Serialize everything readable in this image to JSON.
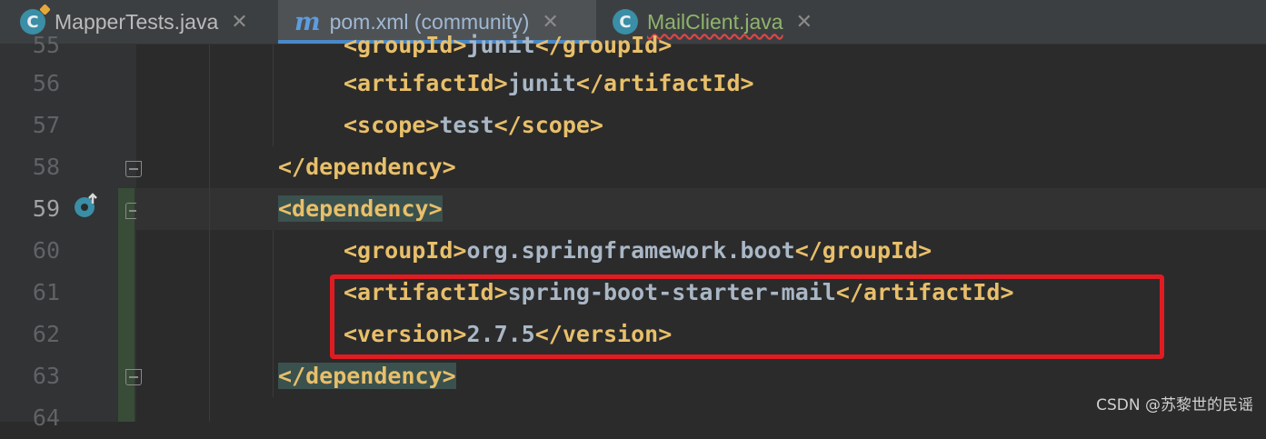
{
  "tabs": [
    {
      "label": "MapperTests.java",
      "icon": "java-class-icon",
      "active": false
    },
    {
      "label": "pom.xml (community)",
      "icon": "maven-icon",
      "active": true
    },
    {
      "label": "MailClient.java",
      "icon": "java-class-icon",
      "active": false
    }
  ],
  "tab_close_glyph": "✕",
  "icon_letters": {
    "class": "C",
    "maven": "m"
  },
  "gutter": {
    "line_numbers": [
      "55",
      "56",
      "57",
      "58",
      "59",
      "60",
      "61",
      "62",
      "63",
      "64"
    ],
    "current_line": "59"
  },
  "code": {
    "line55_open": "<groupId>",
    "line55_text": "junit",
    "line55_close": "</groupId>",
    "line56_open": "<artifactId>",
    "line56_text": "junit",
    "line56_close": "</artifactId>",
    "line57_open": "<scope>",
    "line57_text": "test",
    "line57_close": "</scope>",
    "line58_tag": "</dependency>",
    "line59_tag": "<dependency>",
    "line60_open": "<groupId>",
    "line60_text": "org.springframework.boot",
    "line60_close": "</groupId>",
    "line61_open": "<artifactId>",
    "line61_text": "spring-boot-starter-mail",
    "line61_close": "</artifactId>",
    "line62_open": "<version>",
    "line62_text": "2.7.5",
    "line62_close": "</version>",
    "line63_tag": "</dependency>"
  },
  "colors": {
    "tag": "#e8bf6a",
    "text": "#a9b7c6",
    "highlight_box": "#e11b22",
    "brace_match": "#3b514d"
  },
  "watermark": "CSDN @苏黎世的民谣"
}
